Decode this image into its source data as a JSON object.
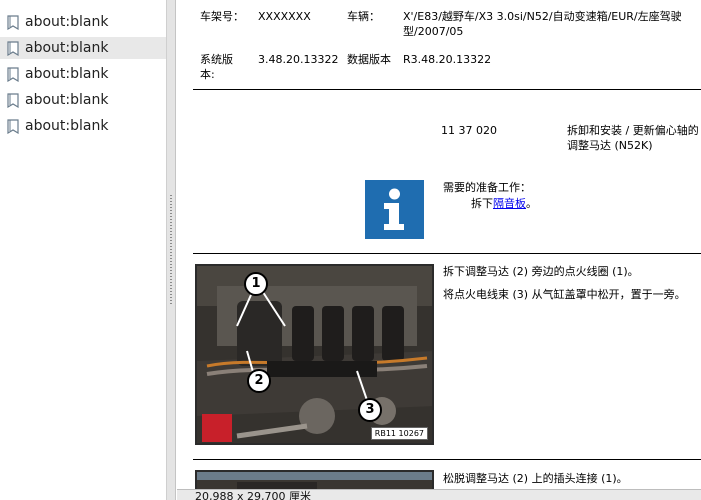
{
  "sidebar": {
    "items": [
      {
        "label": "about:blank",
        "selected": false
      },
      {
        "label": "about:blank",
        "selected": true
      },
      {
        "label": "about:blank",
        "selected": false
      },
      {
        "label": "about:blank",
        "selected": false
      },
      {
        "label": "about:blank",
        "selected": false
      }
    ]
  },
  "header": {
    "chassis_label": "车架号：",
    "chassis_value": "XXXXXXX",
    "vehicle_label": "车辆：",
    "vehicle_value": "X'/E83/越野车/X3 3.0si/N52/自动变速箱/EUR/左座驾驶型/2007/05",
    "system_version_label": "系统版本:",
    "system_version_value": "3.48.20.13322",
    "data_version_label": "数据版本",
    "data_version_value": "R3.48.20.13322"
  },
  "procedure": {
    "code": "11 37 020",
    "title": "拆卸和安装 / 更新偏心轴的调整马达 (N52K)"
  },
  "prerequisites": {
    "heading": "需要的准备工作：",
    "item_prefix": "拆下",
    "item_link": "隔音板",
    "item_suffix": "。"
  },
  "steps": [
    {
      "text_1": "拆下调整马达 (2) 旁边的点火线圈 (1)。",
      "text_2": "将点火电线束 (3) 从气缸盖罩中松开，置于一旁。",
      "photo_ref": "RB11 10267",
      "callouts": [
        "1",
        "2",
        "3"
      ]
    },
    {
      "text_1": "松脱调整马达 (2) 上的插头连接 (1)。"
    }
  ],
  "statusbar": {
    "page_size": "20,988 x 29,700 厘米"
  },
  "colors": {
    "info_blue": "#1f6db0",
    "link": "#0000ee",
    "selected_row": "#e8e8e8"
  }
}
